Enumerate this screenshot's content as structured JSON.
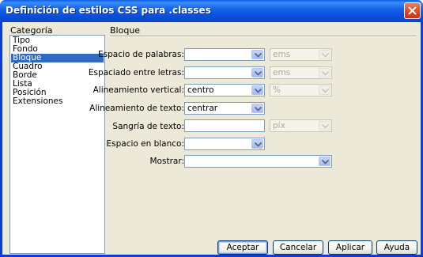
{
  "window": {
    "title": "Definición de estilos CSS para .classes"
  },
  "sidebar": {
    "header": "Categoría",
    "items": [
      {
        "label": "Tipo"
      },
      {
        "label": "Fondo"
      },
      {
        "label": "Bloque",
        "selected": true
      },
      {
        "label": "Cuadro"
      },
      {
        "label": "Borde"
      },
      {
        "label": "Lista"
      },
      {
        "label": "Posición"
      },
      {
        "label": "Extensiones"
      }
    ],
    "selected_color": "#316ac5"
  },
  "panel": {
    "title": "Bloque",
    "fields": {
      "word_spacing": {
        "label": "Espacio de palabras:",
        "value": "",
        "unit": "ems"
      },
      "letter_spacing": {
        "label": "Espaciado entre letras:",
        "value": "",
        "unit": "ems"
      },
      "vertical_align": {
        "label": "Alineamiento vertical:",
        "value": "centro",
        "unit": "%"
      },
      "text_align": {
        "label": "Alineamiento de texto:",
        "value": "centrar"
      },
      "text_indent": {
        "label": "Sangría de texto:",
        "value": "",
        "unit": "píx"
      },
      "white_space": {
        "label": "Espacio en blanco:",
        "value": ""
      },
      "display": {
        "label": "Mostrar:",
        "value": ""
      }
    }
  },
  "buttons": {
    "ok": "Aceptar",
    "cancel": "Cancelar",
    "apply": "Aplicar",
    "help": "Ayuda"
  },
  "colors": {
    "titlebar": "#0a5ee8",
    "dialog_bg": "#ece9d8",
    "close_button": "#d8461c"
  }
}
